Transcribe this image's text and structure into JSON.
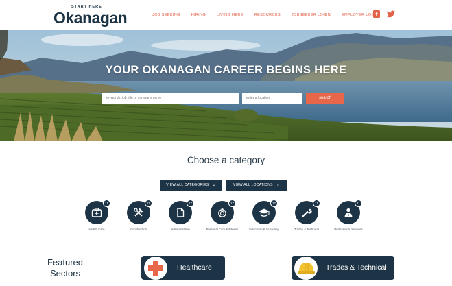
{
  "header": {
    "logo_small": "START HERE",
    "logo_big": "Okanagan",
    "nav": [
      "JOB SEEKING",
      "HIRING",
      "LIVING HERE",
      "RESOURCES",
      "JOBSEEKER LOGIN",
      "EMPLOYER LOGIN"
    ],
    "social": {
      "facebook_icon": "facebook-icon",
      "twitter_icon": "twitter-icon"
    },
    "accent_color": "#e2634a"
  },
  "hero": {
    "title": "YOUR OKANAGAN CAREER BEGINS HERE",
    "keyword_placeholder": "keywords, job title or company name",
    "location_placeholder": "enter a location",
    "search_button": "search"
  },
  "categories": {
    "heading": "Choose a category",
    "view_all_categories": "VIEW ALL CATEGORIES",
    "view_all_locations": "VIEW ALL LOCATIONS",
    "items": [
      {
        "label": "Health Care",
        "count": "11",
        "icon": "medical-kit-icon"
      },
      {
        "label": "Construction",
        "count": "21",
        "icon": "tools-icon"
      },
      {
        "label": "Administration",
        "count": "17",
        "icon": "document-icon"
      },
      {
        "label": "Personal Care & Fitness",
        "count": "17",
        "icon": "stopwatch-icon"
      },
      {
        "label": "Education & Schooling",
        "count": "17",
        "icon": "graduation-cap-icon"
      },
      {
        "label": "Trades & Technical",
        "count": "11",
        "icon": "wrench-icon"
      },
      {
        "label": "Professional Services",
        "count": "11",
        "icon": "person-icon"
      }
    ]
  },
  "featured": {
    "heading_line1": "Featured",
    "heading_line2": "Sectors",
    "sectors": [
      {
        "label": "Healthcare",
        "icon": "medical-cross-icon"
      },
      {
        "label": "Trades & Technical",
        "icon": "hard-hat-icon"
      }
    ]
  },
  "colors": {
    "navy": "#1d3447",
    "orange": "#e8674b"
  }
}
